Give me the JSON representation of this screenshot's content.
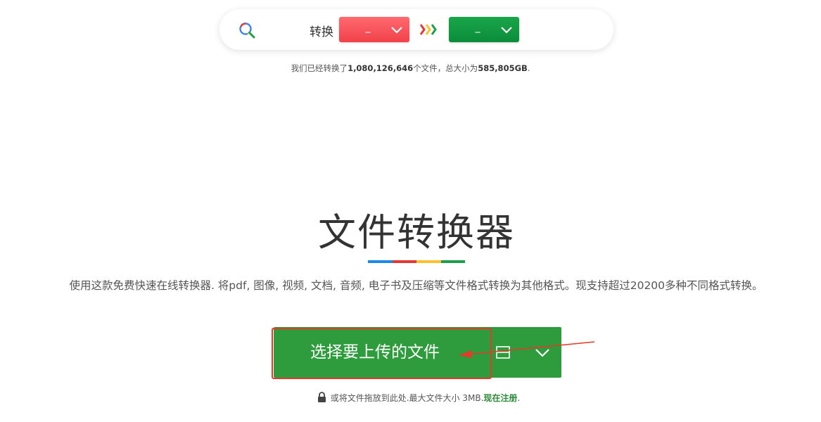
{
  "search_bar": {
    "convert_label": "转换",
    "from_select": {
      "value": "_",
      "color": "#f1414b"
    },
    "to_select": {
      "value": "_",
      "color": "#0b8c3a"
    }
  },
  "stats": {
    "prefix": "我们已经转换了",
    "file_count": "1,080,126,646",
    "middle": "个文件，总大小为",
    "total_size": "585,805GB",
    "suffix": "."
  },
  "main": {
    "title": "文件转换器",
    "underline_colors": [
      "#1e88e5",
      "#e53935",
      "#fbc02d",
      "#1e9e4a"
    ],
    "description": "使用这款免费快速在线转换器. 将pdf, 图像, 视频, 文档, 音频, 电子书及压缩等文件格式转换为其他格式。现支持超过20200多种不同格式转换。"
  },
  "upload": {
    "button_label": "选择要上传的文件",
    "button_color": "#2e9c3c",
    "annotation_color": "#e53a2a"
  },
  "footer": {
    "text": "或将文件拖放到此处.最大文件大小 3MB.",
    "register_link": "现在注册",
    "suffix": "."
  },
  "icons": {
    "search": "search-icon",
    "arrows": "triple-chevron-right-icon",
    "chevron": "chevron-down-icon",
    "cloud": "cloud-storage-icon",
    "lock": "lock-icon"
  }
}
